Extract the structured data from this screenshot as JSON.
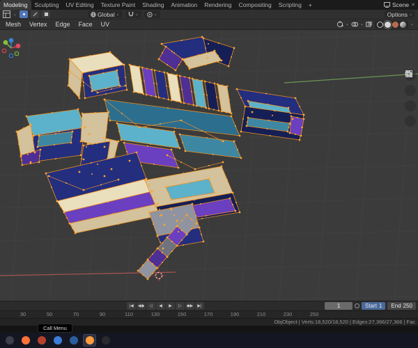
{
  "topbar": {
    "tabs": [
      {
        "label": "Modeling"
      },
      {
        "label": "Sculpting"
      },
      {
        "label": "UV Editing"
      },
      {
        "label": "Texture Paint"
      },
      {
        "label": "Shading"
      },
      {
        "label": "Animation"
      },
      {
        "label": "Rendering"
      },
      {
        "label": "Compositing"
      },
      {
        "label": "Scripting"
      },
      {
        "label": "+"
      }
    ],
    "scene_name": "Scene",
    "close_glyph": "✕"
  },
  "toolheader": {
    "orientation_label": "Global",
    "options_label": "Options",
    "dropdown_glyph": "⌄",
    "menus": [
      {
        "label": "Mesh"
      },
      {
        "label": "Vertex"
      },
      {
        "label": "Edge"
      },
      {
        "label": "Face"
      },
      {
        "label": "UV"
      }
    ]
  },
  "viewport": {
    "background": "#3b3b3b",
    "selection_color": "#ef8f1e",
    "axis_x_color": "#bd5a5a",
    "axis_y_color": "#74a65a"
  },
  "timeline": {
    "transport": [
      {
        "name": "jump-to-start",
        "glyph": "|◀"
      },
      {
        "name": "prev-keyframe",
        "glyph": "◀◆"
      },
      {
        "name": "play-reverse",
        "glyph": "◁"
      },
      {
        "name": "prev-frame",
        "glyph": "◀"
      },
      {
        "name": "next-frame",
        "glyph": "▶"
      },
      {
        "name": "play",
        "glyph": "▷"
      },
      {
        "name": "next-keyframe",
        "glyph": "◆▶"
      },
      {
        "name": "jump-to-end",
        "glyph": "▶|"
      }
    ],
    "ruler": [
      "30",
      "50",
      "70",
      "90",
      "110",
      "130",
      "150",
      "170",
      "190",
      "210",
      "230",
      "250"
    ],
    "frame_current": "1",
    "start_label": "Start",
    "start_value": "1",
    "end_label": "End",
    "end_value": "250"
  },
  "statusbar": {
    "stats": "ObjObject | Verts:18,520/18,520 | Edges:27,366/27,366 | Fac"
  },
  "tooltip": {
    "label": "Call Menu"
  },
  "taskbar": {
    "apps": [
      {
        "name": "app-window",
        "color": "#3c3f4a"
      },
      {
        "name": "app-firefox",
        "color": "#ff7139"
      },
      {
        "name": "app-browser-red",
        "color": "#b5402e"
      },
      {
        "name": "app-edge",
        "color": "#3b7dd8"
      },
      {
        "name": "app-vscode",
        "color": "#2b5e9e"
      },
      {
        "name": "app-blender",
        "color": "#ff9b3c",
        "active": true
      },
      {
        "name": "app-dark",
        "color": "#2a2a2e"
      }
    ]
  }
}
